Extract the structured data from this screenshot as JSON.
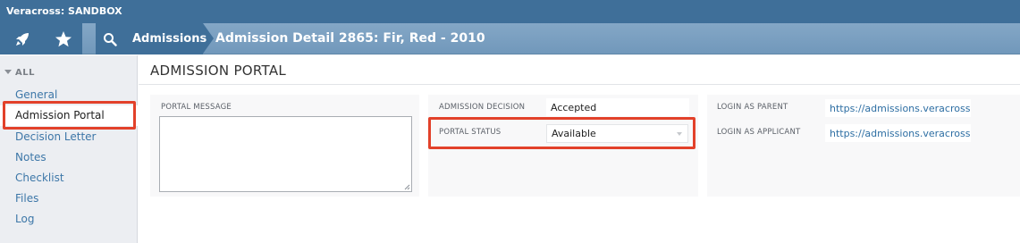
{
  "app": {
    "title": "Veracross: SANDBOX"
  },
  "nav": {
    "rocket_icon": "rocket-icon",
    "star_icon": "star-icon",
    "search_icon": "search-icon",
    "breadcrumb": "Admissions",
    "detail_title": "Admission Detail 2865: Fir, Red - 2010"
  },
  "sidebar": {
    "group_label": "ALL",
    "items": [
      {
        "label": "General"
      },
      {
        "label": "Admission Portal",
        "active": true
      },
      {
        "label": "Decision Letter"
      },
      {
        "label": "Notes"
      },
      {
        "label": "Checklist"
      },
      {
        "label": "Files"
      },
      {
        "label": "Log"
      }
    ]
  },
  "main": {
    "title": "ADMISSION PORTAL",
    "portal_message": {
      "label": "PORTAL MESSAGE",
      "value": ""
    },
    "admission_decision": {
      "label": "ADMISSION DECISION",
      "value": "Accepted"
    },
    "portal_status": {
      "label": "PORTAL STATUS",
      "value": "Available"
    },
    "login_parent": {
      "label": "LOGIN AS PARENT",
      "url": "https://admissions.veracross.com"
    },
    "login_applicant": {
      "label": "LOGIN AS APPLICANT",
      "url": "https://admissions.veracross.com"
    }
  },
  "colors": {
    "highlight": "#e2412a",
    "nav_dark": "#3f6f99",
    "link": "#3d77a8"
  }
}
